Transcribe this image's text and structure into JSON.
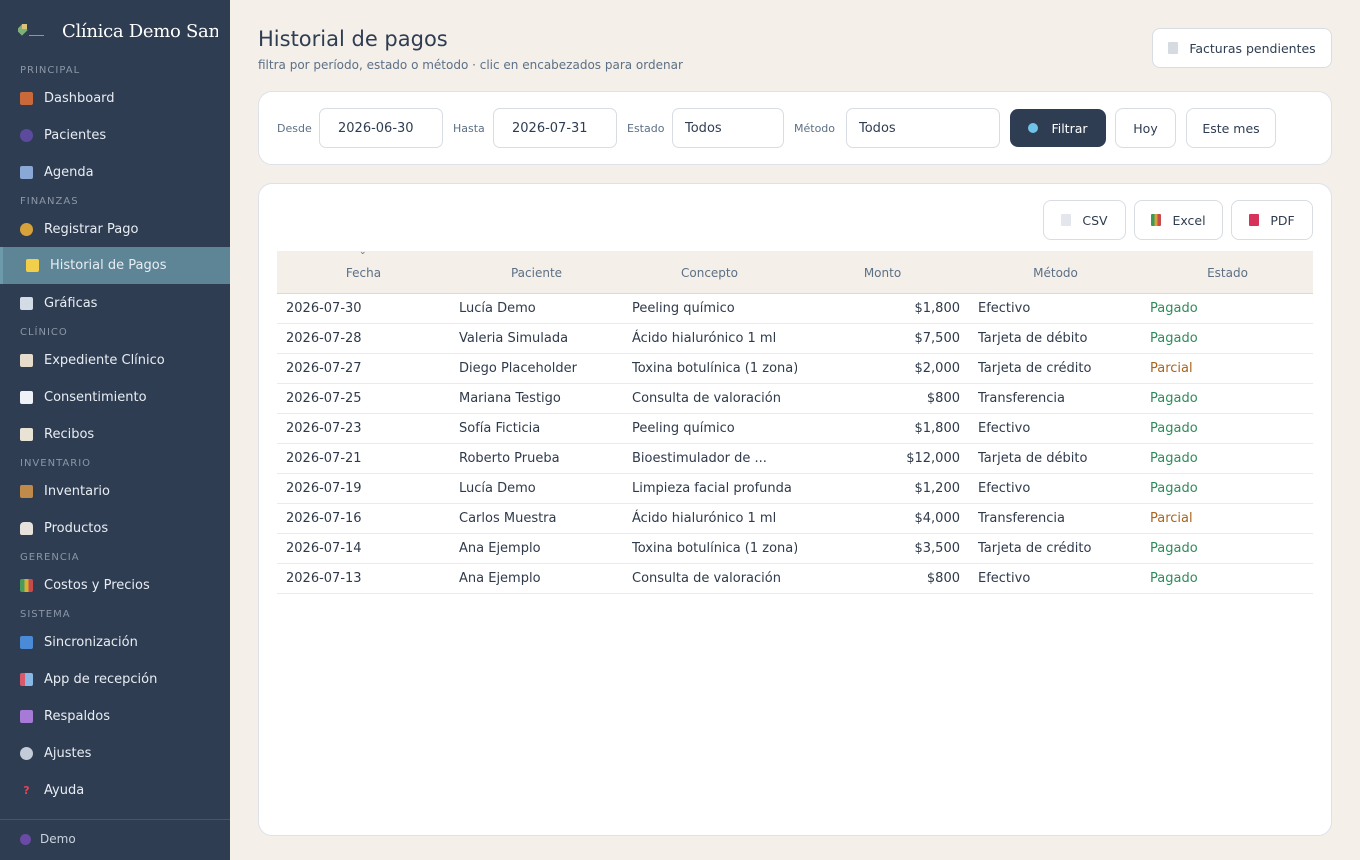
{
  "brand": {
    "name": "Clínica Demo Santo"
  },
  "sidebar": {
    "sections": [
      "PRINCIPAL",
      "FINANZAS",
      "CLÍNICO",
      "INVENTARIO",
      "GERENCIA",
      "SISTEMA"
    ],
    "items": [
      {
        "label": "Dashboard",
        "icon": "house-icon"
      },
      {
        "label": "Pacientes",
        "icon": "people-icon"
      },
      {
        "label": "Agenda",
        "icon": "calendar-icon"
      },
      {
        "label": "Registrar Pago",
        "icon": "money-bag-icon"
      },
      {
        "label": "Historial de Pagos",
        "icon": "ledger-icon",
        "active": true
      },
      {
        "label": "Gráficas",
        "icon": "chart-icon"
      },
      {
        "label": "Expediente Clínico",
        "icon": "clipboard-icon"
      },
      {
        "label": "Consentimiento",
        "icon": "document-icon"
      },
      {
        "label": "Recibos",
        "icon": "receipt-icon"
      },
      {
        "label": "Inventario",
        "icon": "package-icon"
      },
      {
        "label": "Productos",
        "icon": "bottle-icon"
      },
      {
        "label": "Costos y Precios",
        "icon": "bar-chart-icon"
      },
      {
        "label": "Sincronización",
        "icon": "sync-icon"
      },
      {
        "label": "App de recepción",
        "icon": "app-icon"
      },
      {
        "label": "Respaldos",
        "icon": "floppy-icon"
      },
      {
        "label": "Ajustes",
        "icon": "gear-icon"
      },
      {
        "label": "Ayuda",
        "icon": "question-icon"
      }
    ],
    "user": "Demo"
  },
  "header": {
    "title": "Historial de pagos",
    "subtitle": "filtra por período, estado o método · clic en encabezados para ordenar",
    "pending_button": "Facturas pendientes"
  },
  "filters": {
    "from_label": "Desde",
    "from_value": "2026-06-30",
    "to_label": "Hasta",
    "to_value": "2026-07-31",
    "status_label": "Estado",
    "status_value": "Todos",
    "method_label": "Método",
    "method_value": "Todos",
    "filter_button": "Filtrar",
    "today_button": "Hoy",
    "month_button": "Este mes"
  },
  "export": {
    "csv": "CSV",
    "excel": "Excel",
    "pdf": "PDF"
  },
  "table": {
    "columns": [
      "Fecha",
      "Paciente",
      "Concepto",
      "Monto",
      "Método",
      "Estado"
    ],
    "rows": [
      [
        "2026-07-30",
        "Lucía Demo",
        "Peeling químico",
        "$1,800",
        "Efectivo",
        "Pagado"
      ],
      [
        "2026-07-28",
        "Valeria Simulada",
        "Ácido hialurónico 1 ml",
        "$7,500",
        "Tarjeta de débito",
        "Pagado"
      ],
      [
        "2026-07-27",
        "Diego Placeholder",
        "Toxina botulínica (1 zona)",
        "$2,000",
        "Tarjeta de crédito",
        "Parcial"
      ],
      [
        "2026-07-25",
        "Mariana Testigo",
        "Consulta de valoración",
        "$800",
        "Transferencia",
        "Pagado"
      ],
      [
        "2026-07-23",
        "Sofía Ficticia",
        "Peeling químico",
        "$1,800",
        "Efectivo",
        "Pagado"
      ],
      [
        "2026-07-21",
        "Roberto Prueba",
        "Bioestimulador de ...",
        "$12,000",
        "Tarjeta de débito",
        "Pagado"
      ],
      [
        "2026-07-19",
        "Lucía Demo",
        "Limpieza facial profunda",
        "$1,200",
        "Efectivo",
        "Pagado"
      ],
      [
        "2026-07-16",
        "Carlos Muestra",
        "Ácido hialurónico 1 ml",
        "$4,000",
        "Transferencia",
        "Parcial"
      ],
      [
        "2026-07-14",
        "Ana Ejemplo",
        "Toxina botulínica (1 zona)",
        "$3,500",
        "Tarjeta de crédito",
        "Pagado"
      ],
      [
        "2026-07-13",
        "Ana Ejemplo",
        "Consulta de valoración",
        "$800",
        "Efectivo",
        "Pagado"
      ]
    ]
  },
  "colors": {
    "sidebar": "#2f3d52",
    "active": "#5d8596",
    "pagado": "#2f8a5a",
    "parcial": "#a8651e",
    "background": "#f4efe9"
  }
}
